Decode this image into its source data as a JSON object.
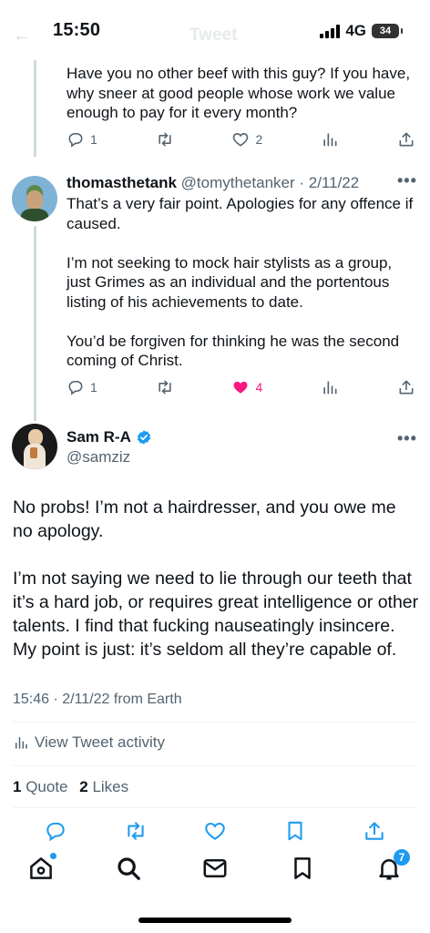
{
  "status_bar": {
    "time": "15:50",
    "network": "4G",
    "battery": "34"
  },
  "header": {
    "title": "Tweet"
  },
  "reply1": {
    "text": "Have you no other beef with this guy? If you have, why sneer at good people whose work we value enough to pay for it every month?",
    "replies": "1",
    "likes": "2"
  },
  "reply2": {
    "name": "thomasthetank",
    "meta": "@tomythetanker · 2/11/22",
    "text": "That’s a very fair point. Apologies for any offence if caused.\n\nI’m not seeking to mock hair stylists as a group, just Grimes as an individual and the portentous listing of his achievements to date.\n\nYou’d be forgiven for thinking he was the second coming of Christ.",
    "replies": "1",
    "likes": "4"
  },
  "main_tweet": {
    "name": "Sam R-A",
    "handle": "@samziz",
    "text": "No probs! I’m not a hairdresser, and you owe me no apology.\n\nI’m not saying we need to lie through our teeth that it’s a hard job, or requires great intelligence or other talents. I find that fucking nauseatingly insincere. My point is just: it’s seldom all they’re capable of.",
    "timestamp": "15:46 · 2/11/22 from Earth",
    "activity_label": "View Tweet activity",
    "quotes_count": "1",
    "quotes_label": "Quote",
    "likes_count": "2",
    "likes_label": "Likes"
  },
  "tab_bar": {
    "notifications_badge": "7"
  },
  "colors": {
    "like_pink": "#f91880",
    "verified_blue": "#1d9bf0",
    "muted": "#536471"
  }
}
